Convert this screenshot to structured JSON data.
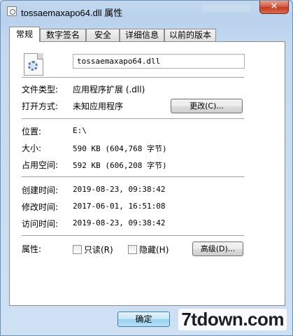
{
  "window": {
    "title": "tossaemaxapo64.dll 属性",
    "close_label": "✕"
  },
  "tabs": [
    {
      "label": "常规",
      "active": true
    },
    {
      "label": "数字签名",
      "active": false
    },
    {
      "label": "安全",
      "active": false
    },
    {
      "label": "详细信息",
      "active": false
    },
    {
      "label": "以前的版本",
      "active": false
    }
  ],
  "file": {
    "icon": "dll-gear-icon",
    "name": "tossaemaxapo64.dll"
  },
  "props": {
    "type_label": "文件类型:",
    "type_value": "应用程序扩展 (.dll)",
    "open_label": "打开方式:",
    "open_value": "未知应用程序",
    "change_button": "更改(C)...",
    "location_label": "位置:",
    "location_value": "E:\\",
    "size_label": "大小:",
    "size_value": "590 KB (604,768 字节)",
    "disk_label": "占用空间:",
    "disk_value": "592 KB (606,208 字节)",
    "created_label": "创建时间:",
    "created_value": "2019-08-23, 09:38:42",
    "modified_label": "修改时间:",
    "modified_value": "2017-06-01, 16:51:08",
    "accessed_label": "访问时间:",
    "accessed_value": "2019-08-23, 09:38:42",
    "attr_label": "属性:",
    "readonly_label": "只读(R)",
    "hidden_label": "隐藏(H)",
    "advanced_button": "高级(D)..."
  },
  "footer": {
    "ok_button": "确定"
  },
  "watermark": "7tdown.com"
}
